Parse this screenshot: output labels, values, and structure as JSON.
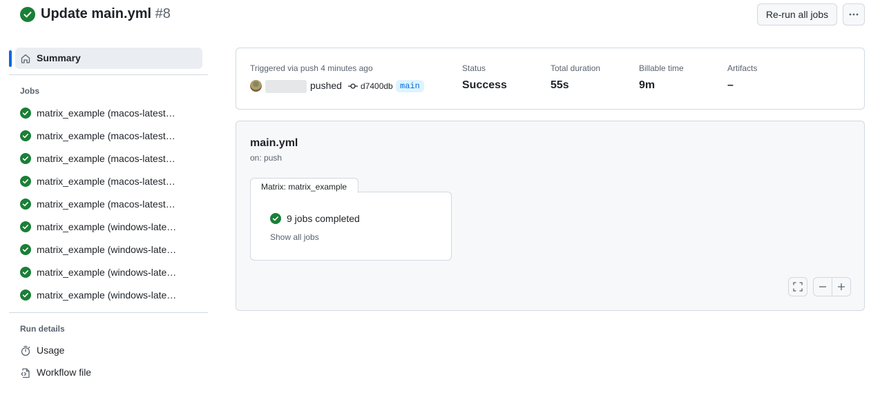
{
  "header": {
    "title": "Update main.yml",
    "run_number": "#8",
    "rerun_label": "Re-run all jobs",
    "more_icon": "kebab-horizontal-icon",
    "status_icon": "check-circle-fill-icon"
  },
  "sidebar": {
    "summary_label": "Summary",
    "summary_icon": "home-icon",
    "jobs_heading": "Jobs",
    "jobs": [
      {
        "label": "matrix_example (macos-latest…"
      },
      {
        "label": "matrix_example (macos-latest…"
      },
      {
        "label": "matrix_example (macos-latest…"
      },
      {
        "label": "matrix_example (macos-latest…"
      },
      {
        "label": "matrix_example (macos-latest…"
      },
      {
        "label": "matrix_example (windows-late…"
      },
      {
        "label": "matrix_example (windows-late…"
      },
      {
        "label": "matrix_example (windows-late…"
      },
      {
        "label": "matrix_example (windows-late…"
      }
    ],
    "run_details_heading": "Run details",
    "usage_label": "Usage",
    "workflow_file_label": "Workflow file"
  },
  "summary": {
    "trigger_text": "Triggered via push 4 minutes ago",
    "pushed_text": "pushed",
    "commit_sha": "d7400db",
    "branch": "main",
    "status_label": "Status",
    "status_value": "Success",
    "duration_label": "Total duration",
    "duration_value": "55s",
    "billable_label": "Billable time",
    "billable_value": "9m",
    "artifacts_label": "Artifacts",
    "artifacts_value": "–"
  },
  "graph": {
    "workflow_name": "main.yml",
    "trigger": "on: push",
    "matrix_label": "Matrix: matrix_example",
    "jobs_completed": "9 jobs completed",
    "show_all": "Show all jobs"
  },
  "colors": {
    "success": "#1a7f37",
    "accent": "#0969da",
    "branch_bg": "#ddf4ff"
  }
}
